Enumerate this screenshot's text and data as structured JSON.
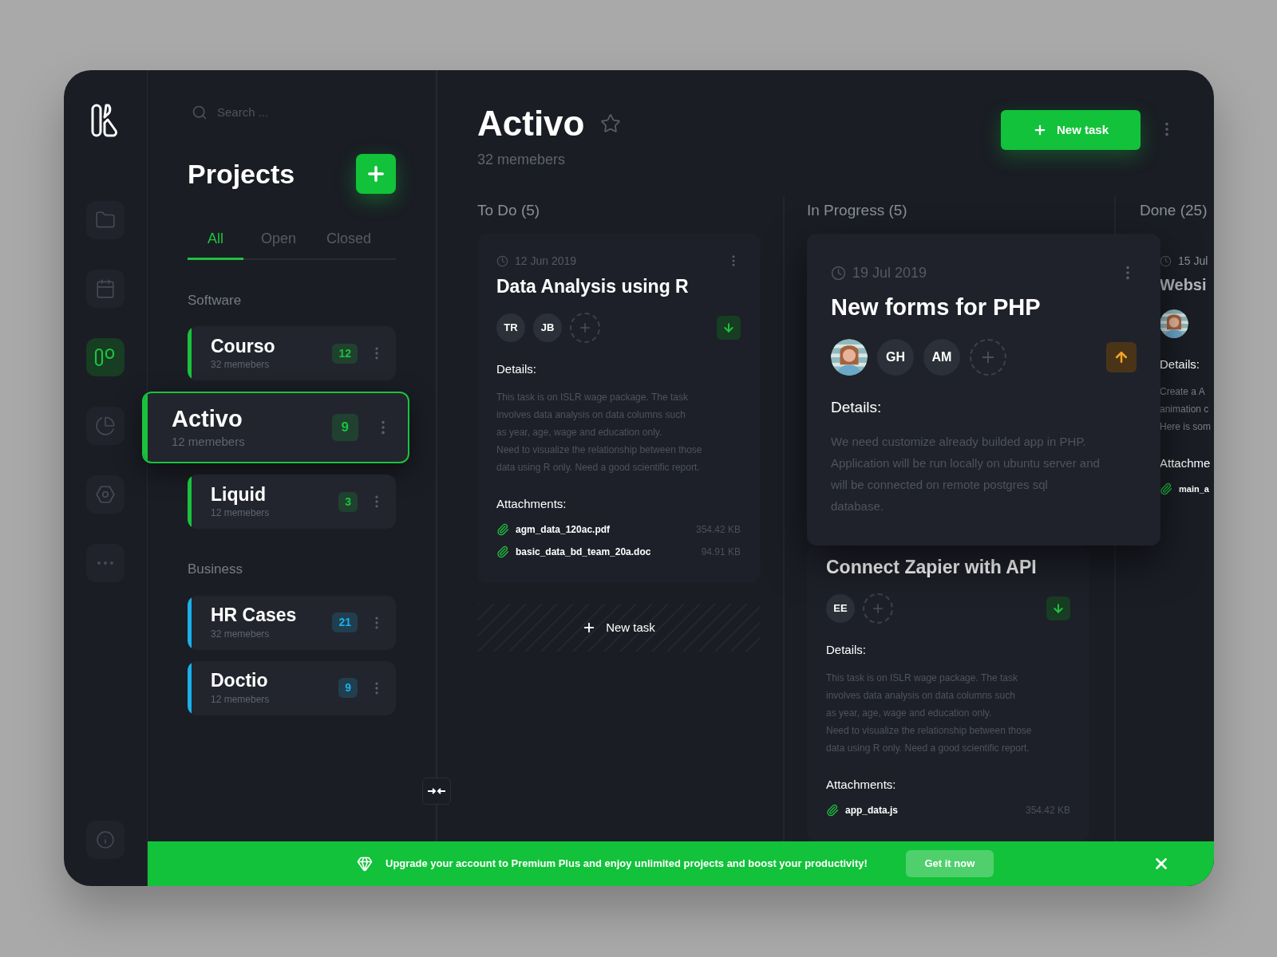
{
  "rail": {
    "items": [
      {
        "selected": false
      },
      {
        "selected": false
      },
      {
        "selected": true
      },
      {
        "selected": false
      },
      {
        "selected": false
      },
      {
        "selected": false
      }
    ],
    "bottom_items": [
      {
        "selected": false
      }
    ]
  },
  "projects_panel": {
    "search": {
      "placeholder": "Search ..."
    },
    "title": "Projects",
    "tabs": [
      {
        "label": "All",
        "selected": true
      },
      {
        "label": "Open",
        "selected": false
      },
      {
        "label": "Closed",
        "selected": false
      }
    ],
    "groups": [
      {
        "label": "Software",
        "projects": [
          {
            "name": "Courso",
            "members": "32 memebers",
            "count": "12",
            "color": "#19c23c",
            "selected": false
          },
          {
            "name": "Activo",
            "members": "12 memebers",
            "count": "9",
            "color": "#19c23c",
            "selected": true
          },
          {
            "name": "Liquid",
            "members": "12 memebers",
            "count": "3",
            "color": "#19c23c",
            "selected": false
          }
        ]
      },
      {
        "label": "Business",
        "projects": [
          {
            "name": "HR Cases",
            "members": "32 memebers",
            "count": "21",
            "color": "#1ab0ea",
            "selected": false
          },
          {
            "name": "Doctio",
            "members": "12 memebers",
            "count": "9",
            "color": "#1ab0ea",
            "selected": false
          }
        ]
      }
    ]
  },
  "board": {
    "title": "Activo",
    "starred": false,
    "members": "32 memebers",
    "new_task_button": "New task",
    "columns": [
      {
        "title": "To Do (5)",
        "add_task": "New task",
        "tasks": [
          {
            "date": "12 Jun 2019",
            "title": "Data Analysis using R",
            "elevated": false,
            "faded": false,
            "raised": false,
            "assignees": [
              {
                "kind": "initials",
                "initials": "TR"
              },
              {
                "kind": "initials",
                "initials": "JB"
              }
            ],
            "details_label": "Details:",
            "details": [
              "This task is on ISLR wage package. The task",
              "involves data analysis on data columns such",
              "as year, age, wage and education only.",
              "Need to visualize the relationship between those",
              "data using R only. Need a good scientific report."
            ],
            "attachments_label": "Attachments:",
            "attachments": [
              {
                "name": "agm_data_120ac.pdf",
                "size": "354.42 KB"
              },
              {
                "name": "basic_data_bd_team_20a.doc",
                "size": "94.91 KB"
              }
            ]
          }
        ]
      },
      {
        "title": "In Progress (5)",
        "tasks": [
          {
            "date": "19 Jul 2019",
            "title": "New forms for PHP",
            "elevated": true,
            "faded": false,
            "raised": true,
            "assignees": [
              {
                "kind": "picture"
              },
              {
                "kind": "initials",
                "initials": "GH"
              },
              {
                "kind": "initials",
                "initials": "AM"
              }
            ],
            "details_label": "Details:",
            "details": [
              "We need customize already builded app in PHP.",
              "Application will be run locally on ubuntu server and",
              "will be connected on remote postgres sql",
              "database."
            ]
          },
          {
            "title": "Connect Zapier with API",
            "elevated": false,
            "faded": false,
            "raised": false,
            "assignees": [
              {
                "kind": "initials",
                "initials": "EE"
              }
            ],
            "details_label": "Details:",
            "details": [
              "This task is on ISLR wage package. The task",
              "involves data analysis on data columns such",
              "as year, age, wage and education only.",
              "Need to visualize the relationship between those",
              "data using R only. Need a good scientific report."
            ],
            "attachments_label": "Attachments:",
            "attachments": [
              {
                "name": "app_data.js",
                "size": "354.42 KB"
              }
            ]
          }
        ]
      },
      {
        "title": "Done (25)",
        "tasks": [
          {
            "date": "15 Jul",
            "title": "Websi",
            "elevated": false,
            "faded": true,
            "assignees": [
              {
                "kind": "picture"
              }
            ],
            "details_label": "Details:",
            "details": [
              "Create a A",
              "animation c",
              "Here is som"
            ],
            "attachments_label": "Attachme",
            "attachments": [
              {
                "name": "main_a"
              }
            ]
          }
        ]
      }
    ]
  },
  "banner": {
    "message": "Upgrade your account to Premium Plus and enjoy unlimited projects and boost your productivity!",
    "button": "Get it now"
  }
}
